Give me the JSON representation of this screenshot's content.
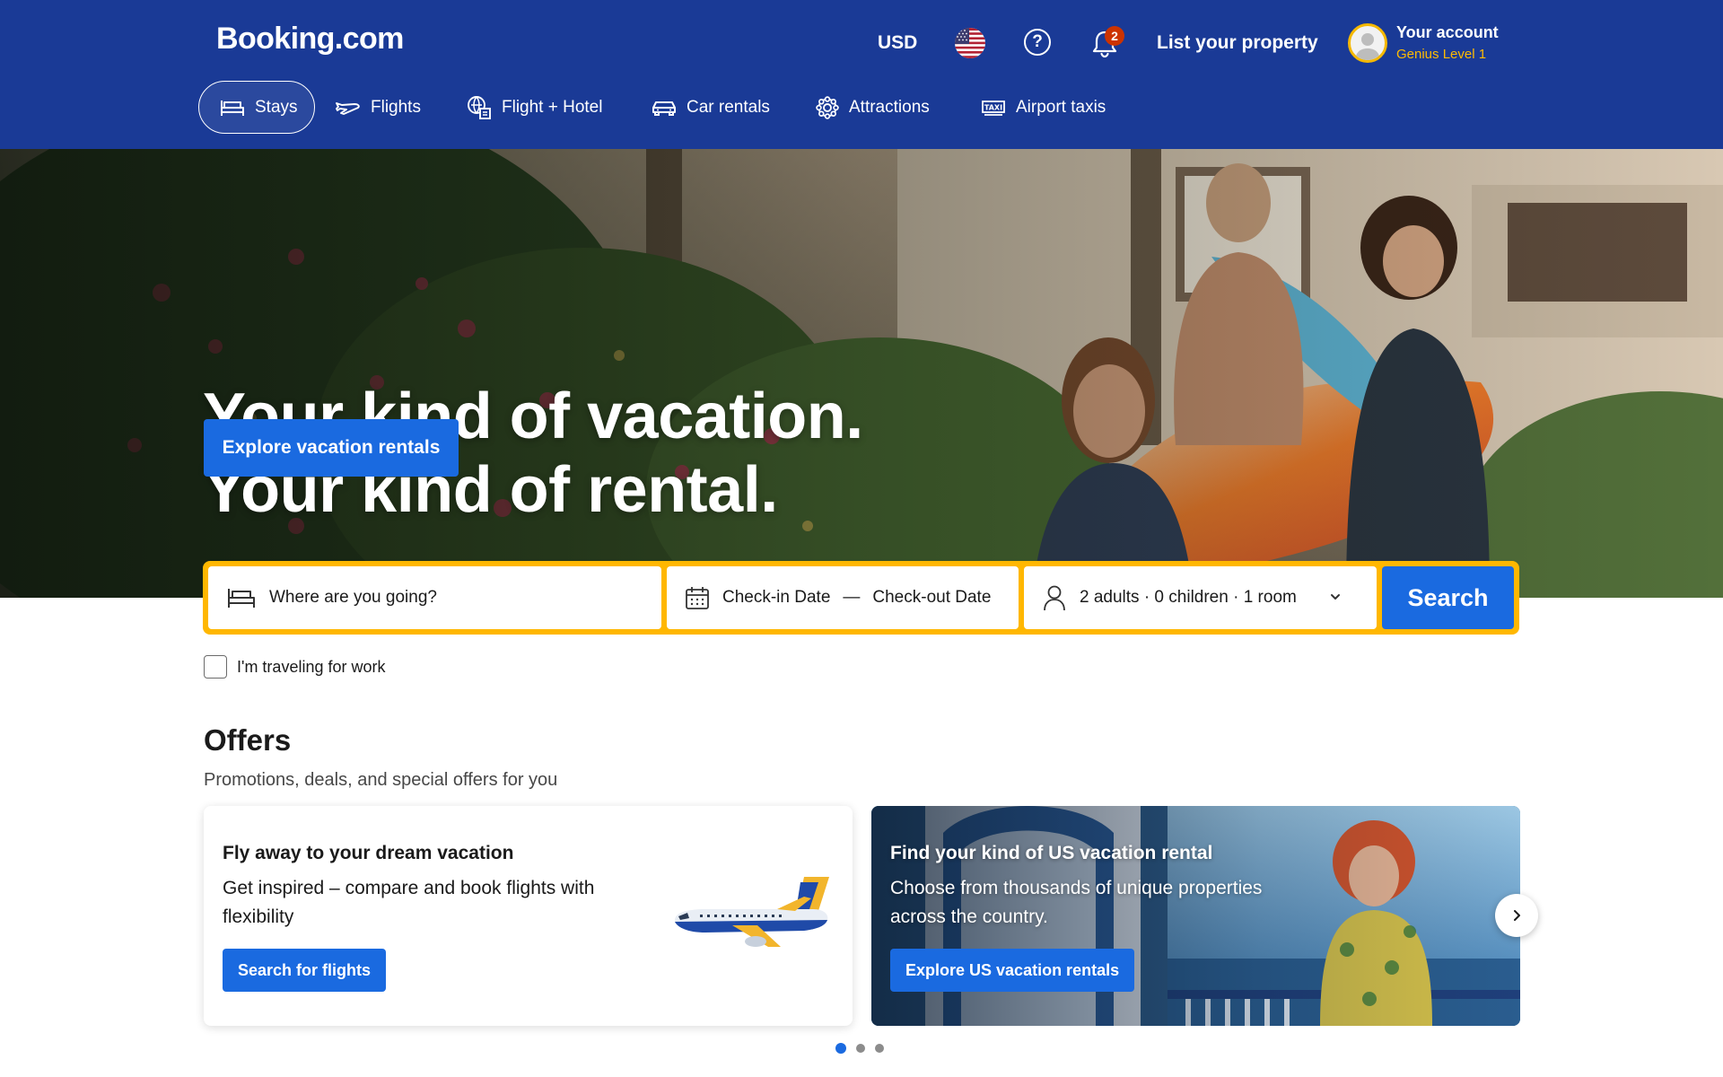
{
  "header": {
    "logo": "Booking.com",
    "currency": "USD",
    "language_icon": "us-flag-icon",
    "help_icon": "question-circle-icon",
    "notifications_count": "2",
    "list_property": "List your property",
    "account_name": "Your account",
    "account_level": "Genius Level 1"
  },
  "nav": {
    "items": [
      {
        "label": "Stays",
        "icon": "bed-icon",
        "active": true
      },
      {
        "label": "Flights",
        "icon": "plane-icon",
        "active": false
      },
      {
        "label": "Flight + Hotel",
        "icon": "flight-hotel-icon",
        "active": false
      },
      {
        "label": "Car rentals",
        "icon": "car-icon",
        "active": false
      },
      {
        "label": "Attractions",
        "icon": "attractions-icon",
        "active": false
      },
      {
        "label": "Airport taxis",
        "icon": "taxi-icon",
        "active": false
      }
    ]
  },
  "hero": {
    "title_line1": "Your kind of vacation.",
    "title_line2": "Your kind of rental.",
    "cta": "Explore vacation rentals"
  },
  "search": {
    "destination_placeholder": "Where are you going?",
    "checkin": "Check-in Date",
    "separator": "—",
    "checkout": "Check-out Date",
    "guests": "2 adults · 0 children · 1 room",
    "button": "Search",
    "work_travel": "I'm traveling for work"
  },
  "offers": {
    "title": "Offers",
    "subtitle": "Promotions, deals, and special offers for you",
    "cards": [
      {
        "title": "Fly away to your dream vacation",
        "text": "Get inspired – compare and book flights with flexibility",
        "button": "Search for flights"
      },
      {
        "title": "Find your kind of US vacation rental",
        "text": "Choose from thousands of unique properties across the country.",
        "button": "Explore US vacation rentals"
      }
    ],
    "carousel_pages": 3,
    "carousel_active": 1
  },
  "colors": {
    "brand_blue": "#1a3a96",
    "action_blue": "#1a6ae0",
    "search_border": "#ffb700",
    "genius_gold": "#febb02",
    "badge_red": "#cc3300"
  }
}
